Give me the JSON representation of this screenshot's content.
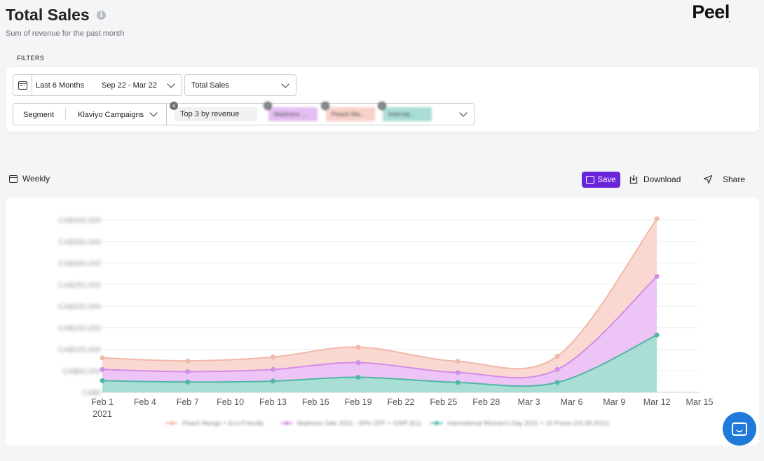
{
  "header": {
    "title": "Total Sales",
    "subtitle": "Sum of revenue for the past month",
    "logo": "Peel"
  },
  "filters": {
    "label": "FILTERS",
    "date_range": "Last 6 Months",
    "date_span": "Sep 22 - Mar 22",
    "metric": "Total Sales",
    "segment_label": "Segment",
    "segment_value": "Klaviyo Campaigns",
    "chips": [
      {
        "label": "Top 3 by revenue"
      },
      {
        "label": "Madness ..."
      },
      {
        "label": "Peach Ma..."
      },
      {
        "label": "Internat..."
      }
    ]
  },
  "toolbar": {
    "interval": "Weekly",
    "save_label": "Save",
    "download_label": "Download",
    "share_label": "Share"
  },
  "colors": {
    "accent": "#6a26d9",
    "series_peach": "#f2b8aa",
    "series_madness": "#d58ce8",
    "series_intl": "#4fb8a6"
  },
  "chart_data": {
    "type": "area",
    "stacked": true,
    "x": [
      "Feb 1",
      "Feb 4",
      "Feb 7",
      "Feb 10",
      "Feb 13",
      "Feb 16",
      "Feb 19",
      "Feb 22",
      "Feb 25",
      "Feb 28",
      "Mar 3",
      "Mar 6",
      "Mar 9",
      "Mar 12",
      "Mar 15"
    ],
    "x_year_label": "2021",
    "y_ticks": [
      "CA$0",
      "CA$50,000",
      "CA$100,000",
      "CA$150,000",
      "CA$200,000",
      "CA$250,000",
      "CA$300,000",
      "CA$350,000",
      "CA$400,000"
    ],
    "ylim": [
      0,
      400000
    ],
    "points_x": [
      1,
      7,
      13,
      19,
      26,
      33,
      40
    ],
    "series": [
      {
        "name": "International Women's Day 2021 + 15 Points (03.08.2021)",
        "values": [
          27000,
          24000,
          26000,
          35000,
          23000,
          23000,
          133000
        ]
      },
      {
        "name": "Madness Sale 2021 - 30% OFF + GWP (E1)",
        "values": [
          26000,
          24000,
          27000,
          34000,
          23000,
          30000,
          136000
        ]
      },
      {
        "name": "Peach Mango + Eco-Friendly",
        "values": [
          27000,
          25000,
          29000,
          36000,
          26000,
          31000,
          134000
        ]
      }
    ],
    "grid": true,
    "legend": "bottom"
  }
}
